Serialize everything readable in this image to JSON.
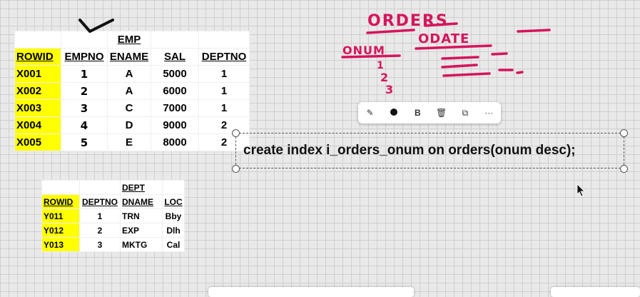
{
  "emp_table": {
    "title": "EMP",
    "headers": [
      "ROWID",
      "EMPNO",
      "ENAME",
      "SAL",
      "DEPTNO"
    ],
    "rows": [
      [
        "X001",
        "1",
        "A",
        "5000",
        "1"
      ],
      [
        "X002",
        "2",
        "A",
        "6000",
        "1"
      ],
      [
        "X003",
        "3",
        "C",
        "7000",
        "1"
      ],
      [
        "X004",
        "4",
        "D",
        "9000",
        "2"
      ],
      [
        "X005",
        "5",
        "E",
        "8000",
        "2"
      ]
    ]
  },
  "dept_table": {
    "title": "DEPT",
    "headers": [
      "ROWID",
      "DEPTNO",
      "DNAME",
      "LOC"
    ],
    "rows": [
      [
        "Y011",
        "1",
        "TRN",
        "Bby"
      ],
      [
        "Y012",
        "2",
        "EXP",
        "Dlh"
      ],
      [
        "Y013",
        "3",
        "MKTG",
        "Cal"
      ]
    ]
  },
  "annotations": {
    "orders": "ORDERS",
    "onum": "ONUM",
    "odate": "ODATE",
    "nums": [
      "1",
      "2",
      "3"
    ]
  },
  "toolbar": {
    "bold_label": "B",
    "more_label": "···",
    "pen_icon": "✎",
    "trash_icon": "🗑",
    "copy_icon": "⧉"
  },
  "textbox": {
    "text": "create index i_orders_onum on orders(onum desc);"
  },
  "colors": {
    "ink": "#d6145c",
    "highlight": "#ffff00"
  }
}
